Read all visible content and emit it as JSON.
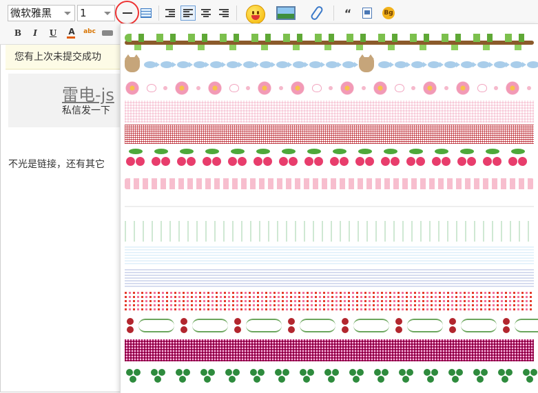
{
  "toolbar": {
    "font_family_value": "微软雅黑",
    "font_size_value": "1",
    "buttons": {
      "bold": "B",
      "italic": "I",
      "underline": "U",
      "font_color": "A",
      "spellcheck": "abc",
      "quote": "“"
    },
    "bg_button_label": "Bg",
    "highlight_color": "#e33333"
  },
  "notice": {
    "text": "您有上次未提交成功"
  },
  "content": {
    "card_title": "雷电-js",
    "card_subtitle": "私信发一下",
    "paragraph": "不光是链接，还有其它"
  },
  "dropdown": {
    "name": "divider-styles",
    "options": [
      "vine-leaves",
      "cat-and-fish",
      "pink-flowers-hearts",
      "pink-check",
      "red-grid",
      "cherries",
      "pink-stars",
      "thin-line",
      "green-vertical-dashes",
      "light-blue-stripes",
      "blue-stripes",
      "red-flower-pattern",
      "roses-and-vines",
      "magenta-pattern",
      "green-clovers"
    ]
  },
  "colors": {
    "accent_highlight": "#e33333",
    "notice_bg": "#fdfbe6",
    "toolbar_bg": "#f7f7f7"
  }
}
